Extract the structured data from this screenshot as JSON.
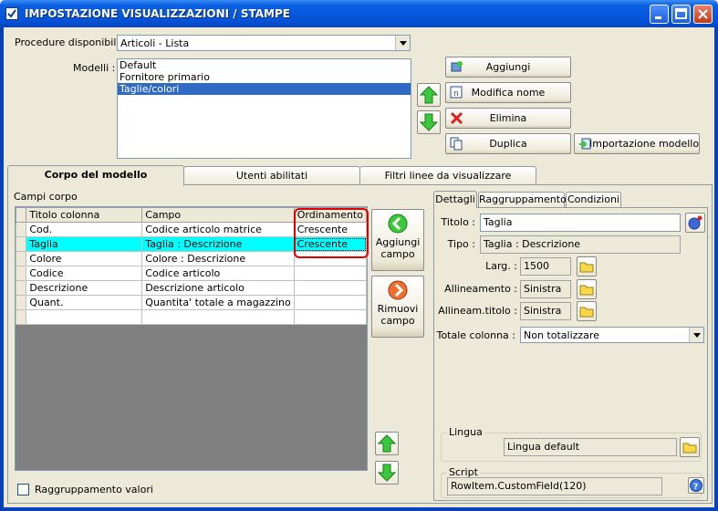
{
  "window": {
    "title": "IMPOSTAZIONE VISUALIZZAZIONI / STAMPE"
  },
  "procedure": {
    "label": "Procedure disponibili :",
    "value": "Articoli - Lista"
  },
  "modelli": {
    "label": "Modelli :",
    "items": [
      "Default",
      "Fornitore primario",
      "Taglie/colori"
    ],
    "selected_index": 2
  },
  "actions": {
    "aggiungi": "Aggiungi",
    "modifica_nome": "Modifica nome",
    "elimina": "Elimina",
    "duplica": "Duplica",
    "importazione": "Importazione modello"
  },
  "tabs": [
    "Corpo del modello",
    "Utenti abilitati",
    "Filtri linee da visualizzare"
  ],
  "campi_corpo": {
    "label": "Campi corpo",
    "columns": [
      "Titolo colonna",
      "Campo",
      "Ordinamento"
    ],
    "rows": [
      {
        "titolo": "Cod.",
        "campo": "Codice articolo matrice",
        "ordinamento": "Crescente"
      },
      {
        "titolo": "Taglia",
        "campo": "Taglia : Descrizione",
        "ordinamento": "Crescente"
      },
      {
        "titolo": "Colore",
        "campo": "Colore : Descrizione",
        "ordinamento": ""
      },
      {
        "titolo": "Codice",
        "campo": "Codice articolo",
        "ordinamento": ""
      },
      {
        "titolo": "Descrizione",
        "campo": "Descrizione articolo",
        "ordinamento": ""
      },
      {
        "titolo": "Quant.",
        "campo": "Quantita' totale a magazzino",
        "ordinamento": ""
      },
      {
        "titolo": "",
        "campo": "",
        "ordinamento": ""
      }
    ],
    "selected_row": 1
  },
  "side_buttons": {
    "aggiungi_campo": [
      "Aggiungi",
      "campo"
    ],
    "rimuovi_campo": [
      "Rimuovi",
      "campo"
    ]
  },
  "raggruppamento_valori": "Raggruppamento valori",
  "detail_tabs": [
    "Dettagli",
    "Raggruppamento",
    "Condizioni"
  ],
  "dettagli": {
    "titolo_label": "Titolo :",
    "titolo_value": "Taglia",
    "tipo_label": "Tipo :",
    "tipo_value": "Taglia : Descrizione",
    "larg_label": "Larg. :",
    "larg_value": "1500",
    "allineamento_label": "Allineamento :",
    "allineamento_value": "Sinistra",
    "allineam_titolo_label": "Allineam.titolo :",
    "allineam_titolo_value": "Sinistra",
    "totale_label": "Totale colonna :",
    "totale_value": "Non totalizzare",
    "lingua_label": "Lingua",
    "lingua_value": "Lingua default",
    "script_label": "Script",
    "script_value": "RowItem.CustomField(120)"
  },
  "colors": {
    "accent": "#0a5fe0",
    "selection": "#316ac5",
    "row_highlight": "#00ffff",
    "marker": "#e00000"
  }
}
